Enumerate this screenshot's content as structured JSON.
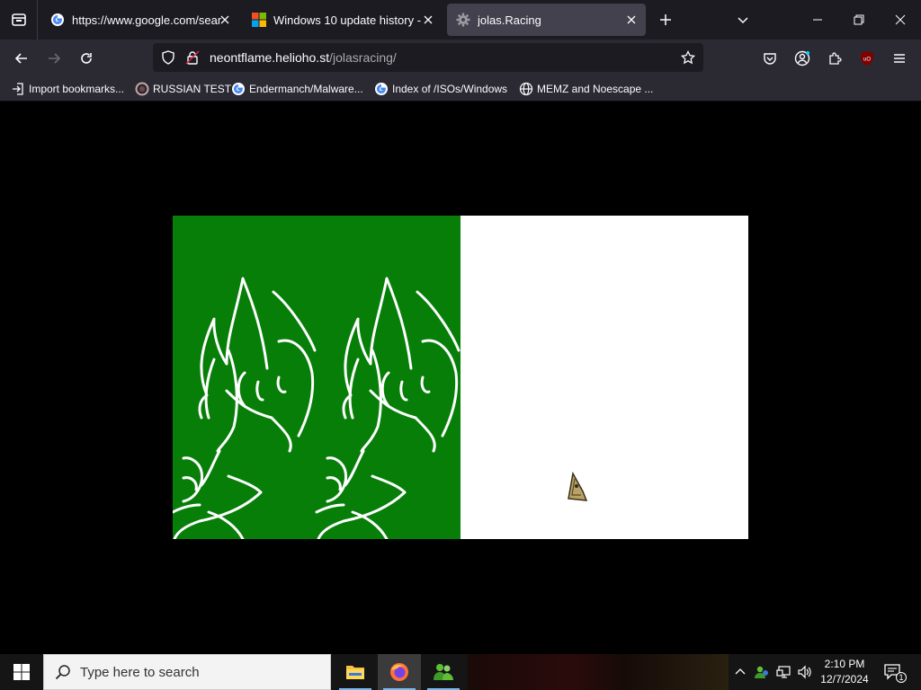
{
  "tabs": [
    {
      "title": "https://www.google.com/searc",
      "favicon": "google-icon",
      "active": false
    },
    {
      "title": "Windows 10 update history - M",
      "favicon": "microsoft-icon",
      "active": false
    },
    {
      "title": "jolas.Racing",
      "favicon": "gear-icon",
      "active": true
    }
  ],
  "urlbar": {
    "host": "neontflame.helioho.st",
    "path": "/jolasracing/"
  },
  "bookmarks": [
    {
      "label": "Import bookmarks...",
      "icon": "import-icon"
    },
    {
      "label": "RUSSIAN TEST",
      "icon": "site-icon"
    },
    {
      "label": "Endermanch/Malware...",
      "icon": "google-icon"
    },
    {
      "label": "Index of /ISOs/Windows",
      "icon": "google-icon"
    },
    {
      "label": "MEMZ and Noescape ...",
      "icon": "globe-icon"
    }
  ],
  "game": {
    "title": "jolas.Racing",
    "left_panel_color": "#067e08",
    "right_panel_color": "#ffffff"
  },
  "taskbar": {
    "search_placeholder": "Type here to search",
    "time": "2:10 PM",
    "date": "12/7/2024",
    "notification_count": "1"
  },
  "colors": {
    "accent": "#067e08",
    "chrome_dark": "#1c1b22",
    "chrome_mid": "#2b2a33"
  }
}
